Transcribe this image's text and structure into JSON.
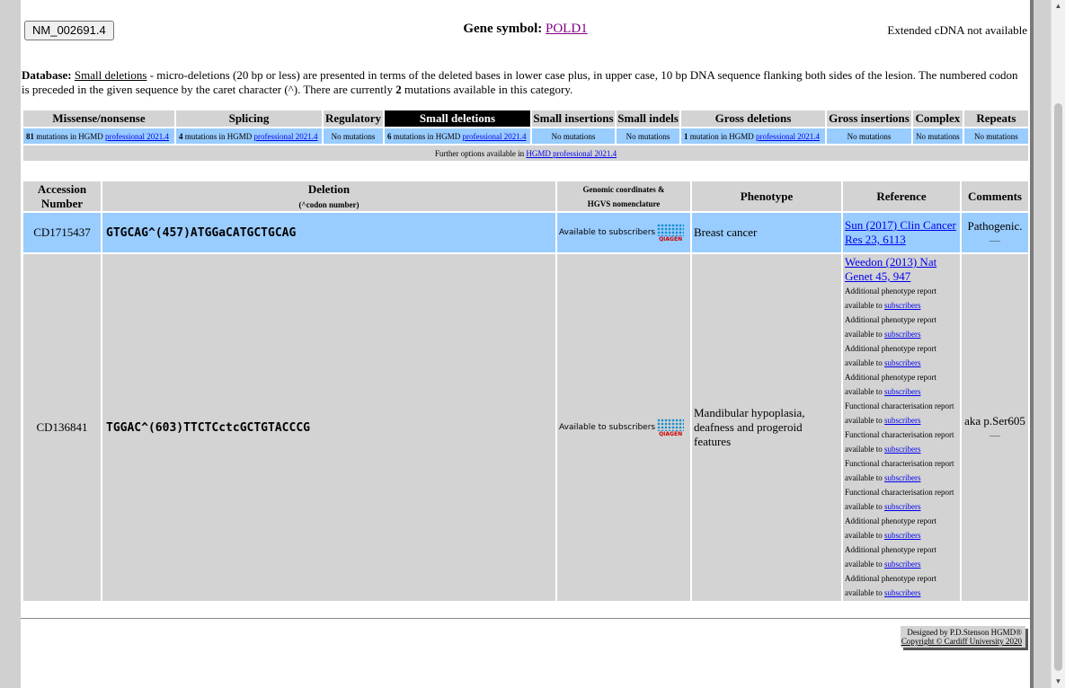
{
  "header": {
    "accession_button": "NM_002691.4",
    "gene_label": "Gene symbol:",
    "gene_symbol": "POLD1",
    "cdna_status": "Extended cDNA not available"
  },
  "database": {
    "label": "Database:",
    "name": "Small deletions",
    "desc_part1": " - micro-deletions (20 bp or less) are presented in terms of the deleted bases in lower case plus, in upper case, 10 bp DNA sequence flanking both sides of the lesion. The numbered codon is preceded in the given sequence by the caret character (^). There are currently ",
    "count": "2",
    "desc_part2": " mutations available in this category."
  },
  "categories": [
    {
      "name": "Missense/nonsense",
      "count": "81",
      "text": " mutations in HGMD ",
      "link": "professional 2021.4"
    },
    {
      "name": "Splicing",
      "count": "4",
      "text": " mutations in HGMD ",
      "link": "professional 2021.4"
    },
    {
      "name": "Regulatory",
      "none": "No mutations"
    },
    {
      "name": "Small deletions",
      "count": "6",
      "text": " mutations in HGMD ",
      "link": "professional 2021.4"
    },
    {
      "name": "Small insertions",
      "none": "No mutations"
    },
    {
      "name": "Small indels",
      "none": "No mutations"
    },
    {
      "name": "Gross deletions",
      "count": "1",
      "text": " mutation in HGMD ",
      "link": "professional 2021.4"
    },
    {
      "name": "Gross insertions",
      "none": "No mutations"
    },
    {
      "name": "Complex",
      "none": "No mutations"
    },
    {
      "name": "Repeats",
      "none": "No mutations"
    }
  ],
  "further": {
    "text": "Further options available in ",
    "link": "HGMD professional 2021.4"
  },
  "table_headers": {
    "accession": "Accession Number",
    "deletion": "Deletion",
    "deletion_sub": "(^codon number)",
    "genomic_1": "Genomic coordinates &",
    "genomic_2": "HGVS nomenclature",
    "phenotype": "Phenotype",
    "reference": "Reference",
    "comments": "Comments"
  },
  "availability": {
    "text": "Available to subscribers",
    "logo": "QIAGEN"
  },
  "rows": [
    {
      "accession": "CD1715437",
      "sequence": "GTGCAG^(457)ATGGaCATGCTGCAG",
      "phenotype": "Breast cancer",
      "reference_link": "Sun (2017) Clin Cancer Res 23, 6113",
      "comment": "Pathogenic.",
      "comment_more": "......"
    },
    {
      "accession": "CD136841",
      "sequence": "TGGAC^(603)TTCTCctcGCTGTACCCG",
      "phenotype": "Mandibular hypoplasia, deafness and progeroid features",
      "reference_link": "Weedon (2013) Nat Genet 45, 947",
      "reports": [
        {
          "text": "Additional phenotype report available to ",
          "link": "subscribers"
        },
        {
          "text": "Additional phenotype report available to ",
          "link": "subscribers"
        },
        {
          "text": "Additional phenotype report available to ",
          "link": "subscribers"
        },
        {
          "text": "Additional phenotype report available to ",
          "link": "subscribers"
        },
        {
          "text": "Functional characterisation report available to ",
          "link": "subscribers"
        },
        {
          "text": "Functional characterisation report available to ",
          "link": "subscribers"
        },
        {
          "text": "Functional characterisation report available to ",
          "link": "subscribers"
        },
        {
          "text": "Functional characterisation report available to ",
          "link": "subscribers"
        },
        {
          "text": "Additional phenotype report available to ",
          "link": "subscribers"
        },
        {
          "text": "Additional phenotype report available to ",
          "link": "subscribers"
        },
        {
          "text": "Additional phenotype report available to ",
          "link": "subscribers"
        }
      ],
      "comment": "aka p.Ser605",
      "comment_more": "......"
    }
  ],
  "footer": {
    "line1": "Designed by P.D.Stenson HGMD®",
    "line2": "Copyright © Cardiff University 2020"
  },
  "colors": {
    "row_blue": "#99ccff",
    "header_grey": "#d3d3d3",
    "active_tab": "#000000",
    "gene_link": "#800080"
  }
}
